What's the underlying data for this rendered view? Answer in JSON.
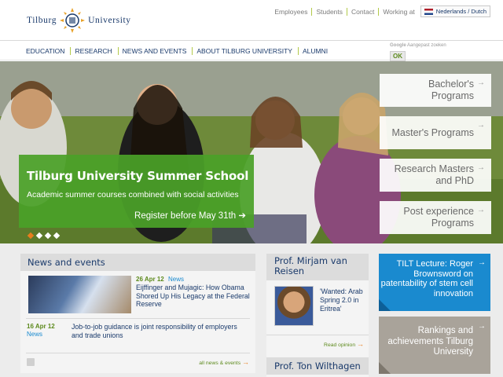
{
  "brand": {
    "left": "Tilburg",
    "right": "University"
  },
  "toplinks": {
    "employees": "Employees",
    "students": "Students",
    "contact": "Contact",
    "working": "Working at",
    "lang": "Nederlands / Dutch"
  },
  "nav": [
    "EDUCATION",
    "RESEARCH",
    "NEWS AND EVENTS",
    "ABOUT TILBURG UNIVERSITY",
    "ALUMNI"
  ],
  "search": {
    "google": "Google",
    "placeholder": "Aangepast zoeken",
    "button": "OK"
  },
  "hero": {
    "title": "Tilburg University Summer School",
    "subtitle": "Academic summer courses combined with social activities",
    "cta": "Register before May 31th"
  },
  "programs": [
    {
      "label_1": "Bachelor's",
      "label_2": "Programs"
    },
    {
      "label_1": "Master's Programs",
      "label_2": ""
    },
    {
      "label_1": "Research Masters",
      "label_2": "and PhD"
    },
    {
      "label_1": "Post experience",
      "label_2": "Programs"
    }
  ],
  "news": {
    "heading": "News and events",
    "item1": {
      "date": "26 Apr 12",
      "category": "News",
      "title": "Eijffinger and Mujagic: How Obama Shored Up His Legacy at the Federal Reserve"
    },
    "item2": {
      "date": "16 Apr 12",
      "category": "News",
      "title": "Job-to-job guidance is joint responsibility of employers and trade unions"
    },
    "all_link": "all news & events"
  },
  "prof1": {
    "name": "Prof. Mirjam van Reisen",
    "quote": "'Wanted: Arab Spring 2.0 in Eritrea'",
    "read": "Read opinion"
  },
  "prof2": {
    "name": "Prof. Ton Wilthagen"
  },
  "tilt": {
    "text": "TILT Lecture: Roger Brownsword on patentability of stem cell innovation"
  },
  "rankings": {
    "text": "Rankings and achievements Tilburg University"
  },
  "colors": {
    "navy": "#1a3a6b",
    "green": "#4aa028",
    "blue": "#1a8acf",
    "taupe": "#a9a39a",
    "orange": "#e87d1e"
  }
}
